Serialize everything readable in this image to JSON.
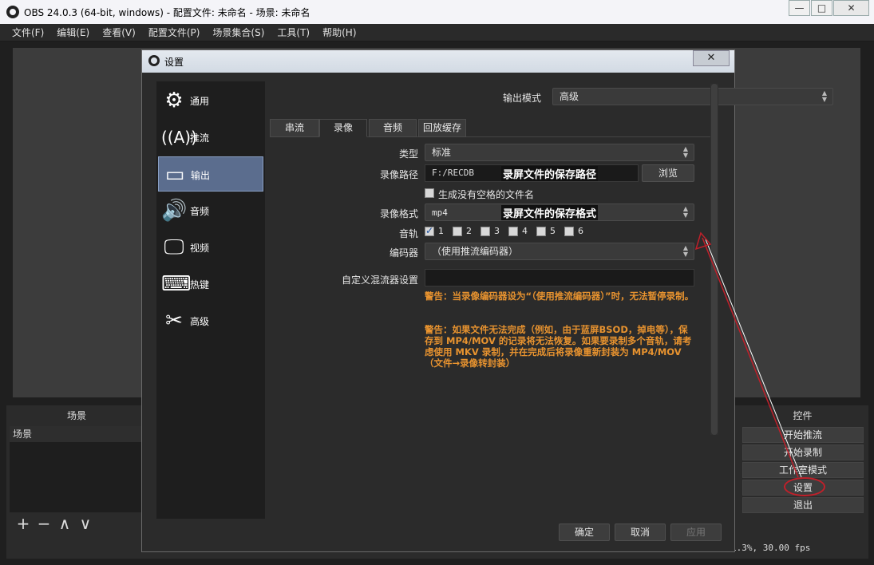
{
  "window": {
    "title": "OBS 24.0.3 (64-bit, windows) - 配置文件: 未命名 - 场景: 未命名",
    "controls": {
      "minimize": "—",
      "maximize": "□",
      "close": "✕"
    }
  },
  "menu": [
    "文件(F)",
    "编辑(E)",
    "查看(V)",
    "配置文件(P)",
    "场景集合(S)",
    "工具(T)",
    "帮助(H)"
  ],
  "scenes_dock": {
    "title": "场景",
    "header": "场景",
    "tools": [
      "+",
      "−",
      "∧",
      "∨"
    ]
  },
  "controls_dock": {
    "title": "控件",
    "buttons": [
      "开始推流",
      "开始录制",
      "工作室模式",
      "设置",
      "退出"
    ]
  },
  "status": {
    "text": "1.3%, 30.00 fps"
  },
  "settings": {
    "title": "设置",
    "close": "✕",
    "sidebar": [
      {
        "label": "通用",
        "icon": "gear-icon"
      },
      {
        "label": "推流",
        "icon": "antenna-icon"
      },
      {
        "label": "输出",
        "icon": "output-icon"
      },
      {
        "label": "音频",
        "icon": "speaker-icon"
      },
      {
        "label": "视频",
        "icon": "monitor-icon"
      },
      {
        "label": "热键",
        "icon": "keyboard-icon"
      },
      {
        "label": "高级",
        "icon": "tools-icon"
      }
    ],
    "output_mode": {
      "label": "输出模式",
      "value": "高级"
    },
    "tabs": [
      "串流",
      "录像",
      "音频",
      "回放缓存"
    ],
    "active_tab": "录像",
    "type": {
      "label": "类型",
      "value": "标准"
    },
    "record_path": {
      "label": "录像路径",
      "value": "F:/RECDB",
      "note": "录屏文件的保存路径",
      "browse": "浏览"
    },
    "no_space": {
      "label": "生成没有空格的文件名"
    },
    "format": {
      "label": "录像格式",
      "value": "mp4",
      "note": "录屏文件的保存格式"
    },
    "tracks": {
      "label": "音轨",
      "items": [
        "1",
        "2",
        "3",
        "4",
        "5",
        "6"
      ]
    },
    "encoder": {
      "label": "编码器",
      "value": "（使用推流编码器）"
    },
    "muxer": {
      "label": "自定义混流器设置",
      "value": ""
    },
    "warnings": [
      "警告：当录像编码器设为“（使用推流编码器）”时，无法暂停录制。",
      "警告：如果文件无法完成（例如，由于蓝屏BSOD，掉电等），保存到 MP4/MOV 的记录将无法恢复。如果要录制多个音轨，请考虑使用 MKV 录制，并在完成后将录像重新封装为 MP4/MOV（文件→录像转封装）"
    ],
    "buttons": {
      "ok": "确定",
      "cancel": "取消",
      "apply": "应用"
    }
  }
}
